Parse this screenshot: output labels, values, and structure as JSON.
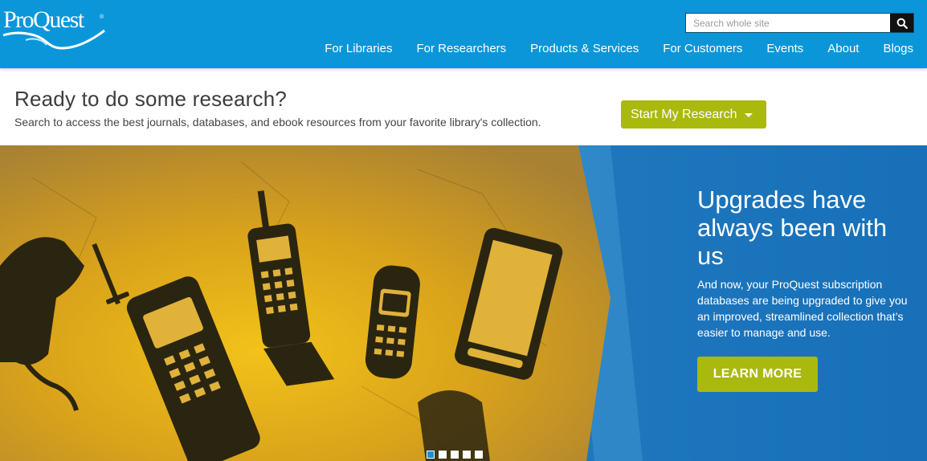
{
  "brand": {
    "logo_text": "ProQuest",
    "trademark": "®",
    "primary_color": "#0b96d9",
    "accent_color": "#aab90e"
  },
  "search": {
    "placeholder": "Search whole site",
    "value": "",
    "icon": "search-icon"
  },
  "nav": {
    "items": [
      {
        "label": "For Libraries"
      },
      {
        "label": "For Researchers"
      },
      {
        "label": "Products & Services"
      },
      {
        "label": "For Customers"
      },
      {
        "label": "Events"
      },
      {
        "label": "About"
      },
      {
        "label": "Blogs"
      }
    ]
  },
  "research": {
    "title": "Ready to do some research?",
    "subtitle": "Search to access the best journals, databases, and ebook resources from your favorite library's collection.",
    "button_label": "Start My Research",
    "button_icon": "caret-down-icon"
  },
  "hero": {
    "title": "Upgrades have always been with us",
    "text": "And now, your ProQuest subscription databases are being upgraded to give you an improved, streamlined collection that’s easier to manage and use.",
    "button_label": "LEARN MORE",
    "background_color": "#1770b8",
    "art": "phone-evolution-illustration"
  },
  "carousel": {
    "slide_count": 5,
    "active_index": 0
  }
}
